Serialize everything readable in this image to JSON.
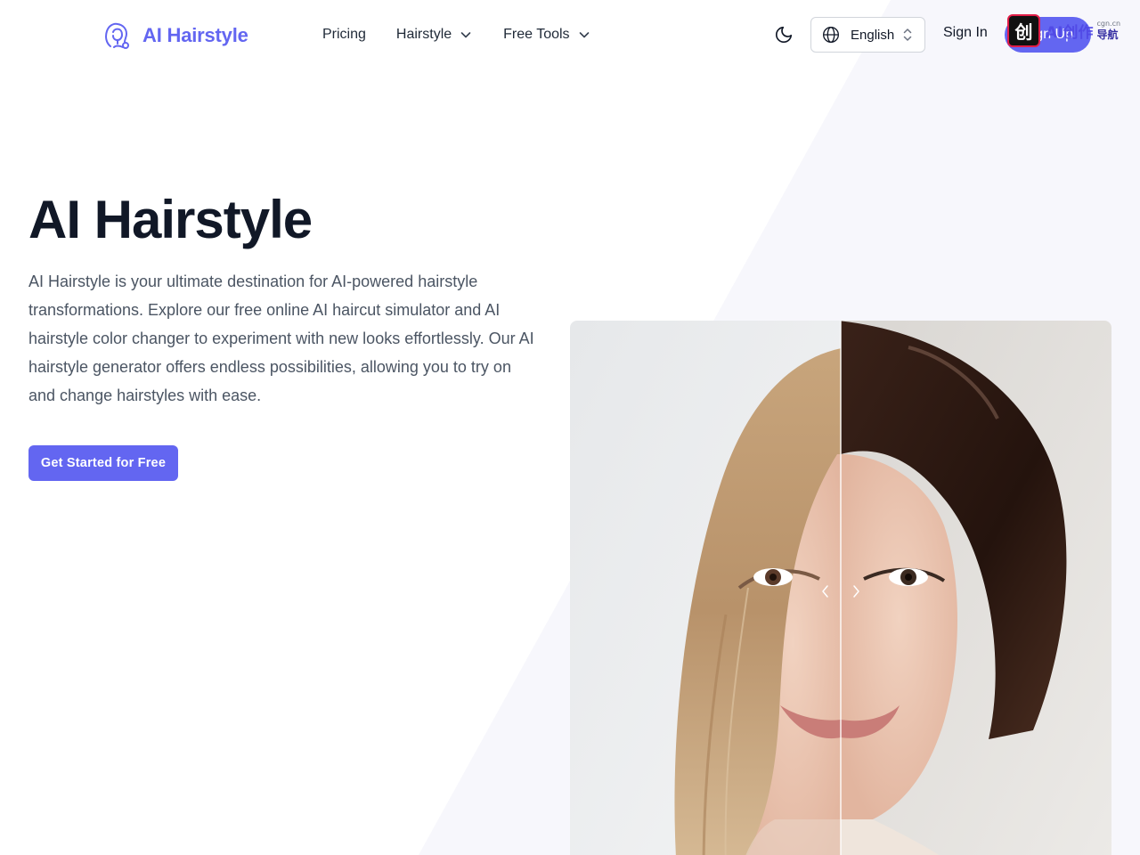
{
  "header": {
    "logo_text": "AI Hairstyle",
    "nav": [
      {
        "label": "Pricing",
        "has_dropdown": false
      },
      {
        "label": "Hairstyle",
        "has_dropdown": true
      },
      {
        "label": "Free Tools",
        "has_dropdown": true
      }
    ],
    "language_select": {
      "value": "English"
    },
    "signin_label": "Sign In",
    "signup_label": "Sign Up",
    "overlay_badge": {
      "icon_text": "创",
      "text": "AI创作",
      "small": "cgn.cn",
      "nav": "导航"
    }
  },
  "hero": {
    "title": "AI Hairstyle",
    "description": "AI Hairstyle is your ultimate destination for AI-powered hairstyle transformations. Explore our free online AI haircut simulator and AI hairstyle color changer to experiment with new looks effortlessly. Our AI hairstyle generator offers endless possibilities, allowing you to try on and change hairstyles with ease.",
    "cta_label": "Get Started for Free"
  },
  "colors": {
    "accent": "#6366f1",
    "text_dark": "#111827",
    "text_muted": "#4b5563",
    "bg_tint": "#f7f7fc"
  },
  "icons": [
    "hair-logo-icon",
    "chevron-down-icon",
    "moon-icon",
    "globe-icon",
    "updown-icon",
    "chevron-left-icon",
    "chevron-right-icon"
  ]
}
